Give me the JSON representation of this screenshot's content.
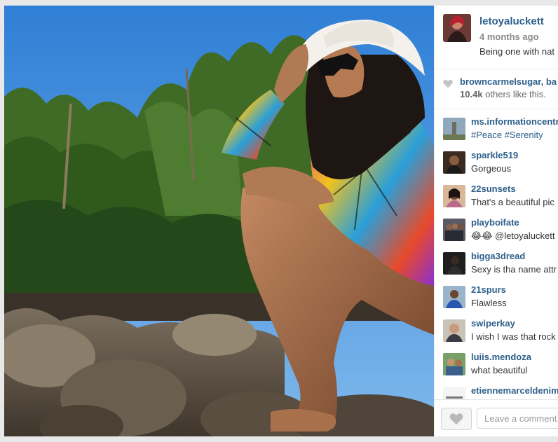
{
  "post": {
    "username": "letoyaluckett",
    "time_ago": "4 months ago",
    "caption": "Being one with nat"
  },
  "likes": {
    "likers": "browncarmelsugar, ba",
    "count": "10.4k",
    "count_suffix": " others like this."
  },
  "comments": [
    {
      "user": "ms.informationcentr",
      "text": "#Peace #Serenity",
      "is_tags": true,
      "avatar": "memorial-statue-avatar"
    },
    {
      "user": "sparkle519",
      "text": "Gorgeous",
      "is_tags": false,
      "avatar": "dark-portrait-avatar"
    },
    {
      "user": "22sunsets",
      "text": "That's a beautiful pic",
      "is_tags": false,
      "avatar": "woman-portrait-avatar"
    },
    {
      "user": "playboifate",
      "text": "😂😂 @letoyaluckett",
      "is_tags": false,
      "avatar": "group-photo-avatar"
    },
    {
      "user": "bigga3dread",
      "text": "Sexy is tha name attr",
      "is_tags": false,
      "avatar": "dark-figure-avatar"
    },
    {
      "user": "21spurs",
      "text": "Flawless",
      "is_tags": false,
      "avatar": "man-blue-shirt-avatar"
    },
    {
      "user": "swiperkay",
      "text": "I wish I was that rock",
      "is_tags": false,
      "avatar": "man-portrait-avatar"
    },
    {
      "user": "luiis.mendoza",
      "text": "what beautiful",
      "is_tags": false,
      "avatar": "outdoor-group-avatar"
    },
    {
      "user": "etiennemarceldenim",
      "text": "",
      "is_tags": false,
      "avatar": "brand-logo-avatar"
    }
  ],
  "footer": {
    "comment_placeholder": "Leave a comment..."
  },
  "colors": {
    "link": "#2d5f8a",
    "muted": "#8a8a8a",
    "sky": "#3d8ee0"
  }
}
